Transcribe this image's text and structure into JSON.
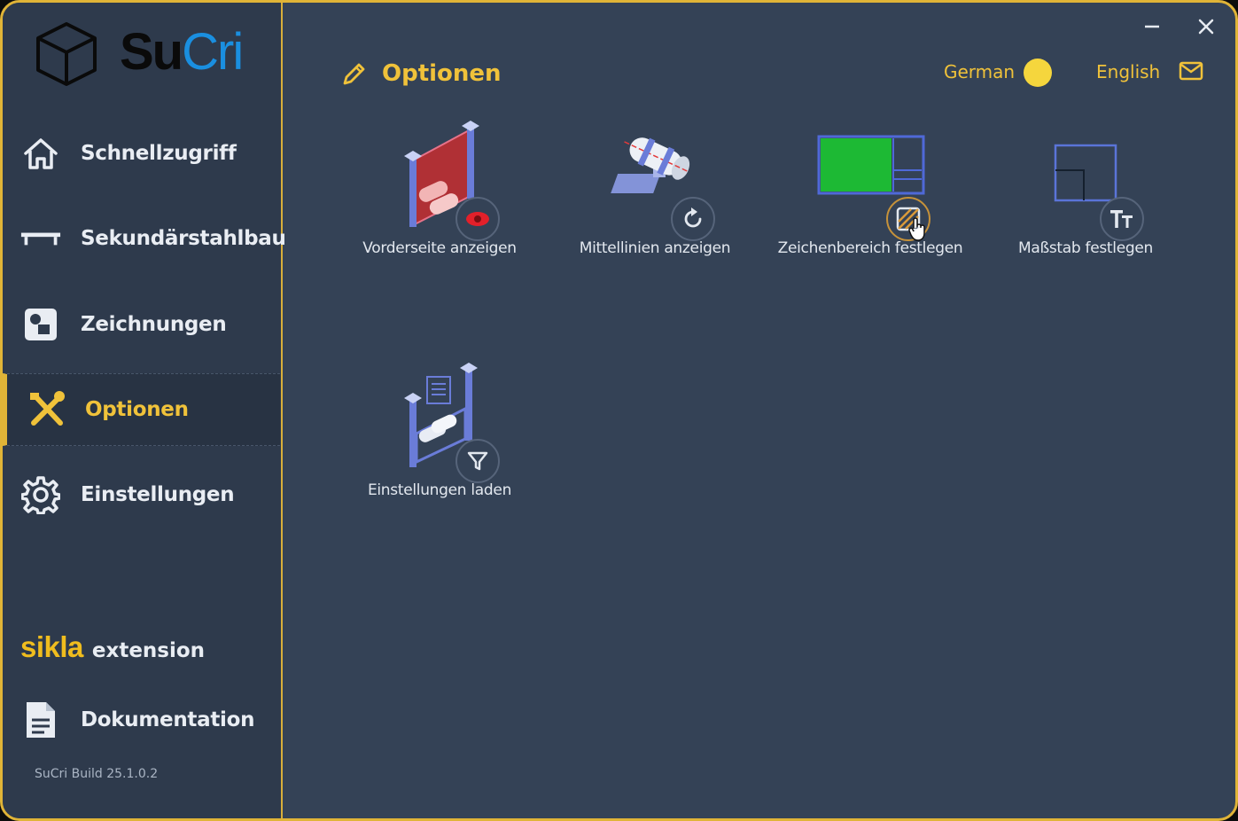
{
  "app": {
    "brand_su": "Su",
    "brand_cri": "Cri",
    "build": "SuCri Build 25.1.0.2"
  },
  "sidebar": {
    "items": [
      {
        "label": "Schnellzugriff",
        "icon": "home-icon"
      },
      {
        "label": "Sekundärstahlbau",
        "icon": "beam-icon"
      },
      {
        "label": "Zeichnungen",
        "icon": "drawing-icon"
      },
      {
        "label": "Optionen",
        "icon": "tools-icon",
        "active": true
      },
      {
        "label": "Einstellungen",
        "icon": "gear-icon"
      }
    ],
    "sikla_brand": "sikla",
    "sikla_extension": "extension",
    "documentation": "Dokumentation"
  },
  "header": {
    "title": "Optionen",
    "icon": "pencil-icon"
  },
  "language": {
    "left": "German",
    "right": "English",
    "toggle_color": "#f5d63d"
  },
  "tiles": [
    {
      "label": "Vorderseite anzeigen",
      "badge_icon": "eye-icon"
    },
    {
      "label": "Mittellinien anzeigen",
      "badge_icon": "refresh-icon"
    },
    {
      "label": "Zeichenbereich festlegen",
      "badge_icon": "hatch-icon"
    },
    {
      "label": "Maßstab festlegen",
      "badge_icon": "text-size-icon"
    },
    {
      "label": "Einstellungen laden",
      "badge_icon": "filter-icon"
    }
  ],
  "colors": {
    "accent": "#f0c23a",
    "background": "#344256",
    "sidebar": "#2e3a4c",
    "brand_blue": "#1a8fe0"
  }
}
